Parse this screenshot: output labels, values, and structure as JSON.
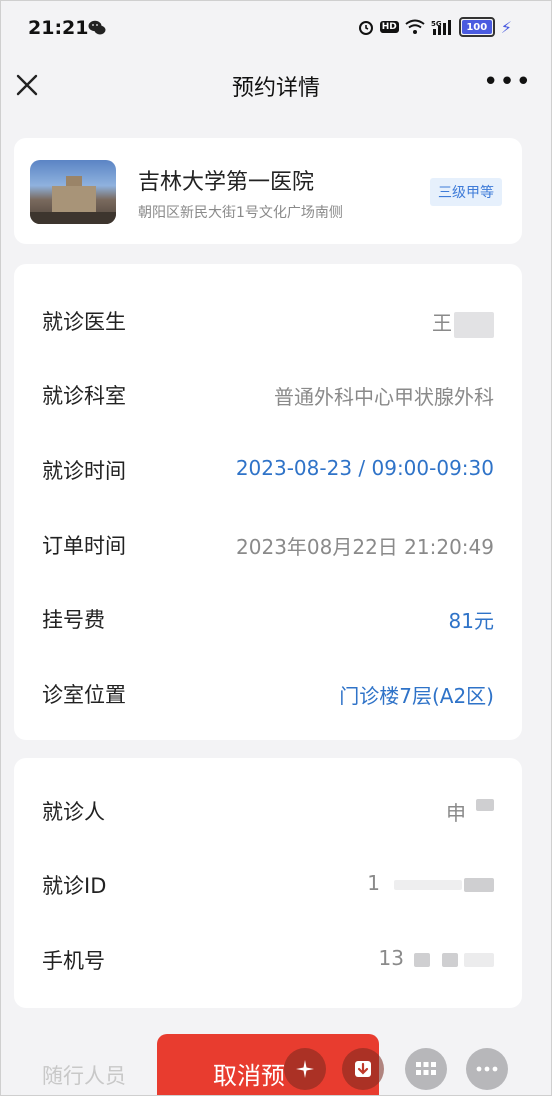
{
  "status_bar": {
    "time": "21:21",
    "signal": "5G",
    "battery": "100"
  },
  "nav": {
    "title": "预约详情",
    "more": "•••"
  },
  "hospital": {
    "name": "吉林大学第一医院",
    "address": "朝阳区新民大街1号文化广场南侧",
    "grade": "三级甲等"
  },
  "appointment": {
    "rows": [
      {
        "label": "就诊医生",
        "value": "王"
      },
      {
        "label": "就诊科室",
        "value": "普通外科中心甲状腺外科"
      },
      {
        "label": "就诊时间",
        "value": "2023-08-23 / 09:00-09:30"
      },
      {
        "label": "订单时间",
        "value": "2023年08月22日 21:20:49"
      },
      {
        "label": "挂号费",
        "value": "81元"
      },
      {
        "label": "诊室位置",
        "value": "门诊楼7层(A2区)"
      }
    ]
  },
  "patient": {
    "rows": [
      {
        "label": "就诊人",
        "value": "申"
      },
      {
        "label": "就诊ID",
        "value": "1"
      },
      {
        "label": "手机号",
        "value": "13"
      }
    ]
  },
  "footer": {
    "companion_label": "随行人员",
    "cancel_label": "取消预"
  },
  "colors": {
    "accent_blue": "#2f73c8",
    "cancel_red": "#e83c2f",
    "grade_badge_bg": "#e6f0fc"
  }
}
